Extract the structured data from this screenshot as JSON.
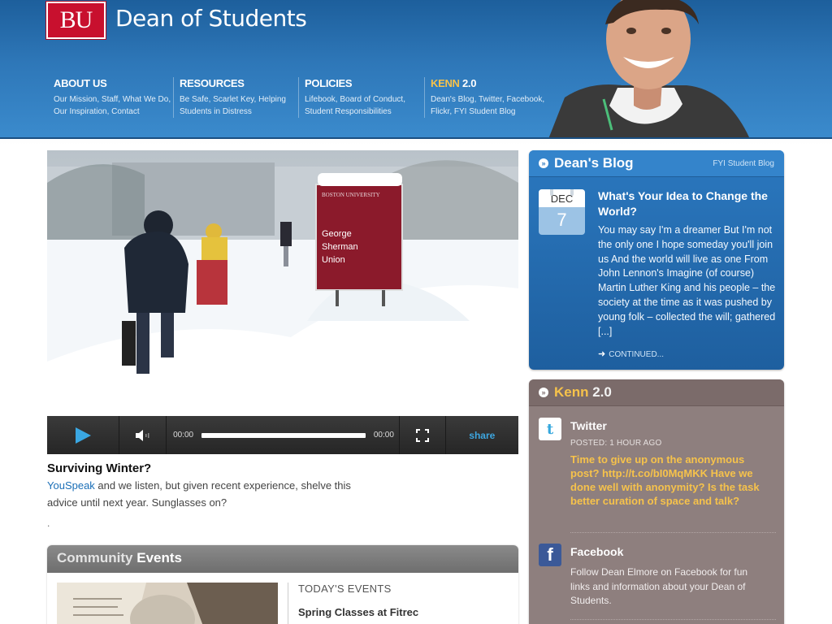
{
  "header": {
    "logo_text": "BU",
    "site_title": "Dean of Students",
    "nav": [
      {
        "title": "ABOUT US",
        "sub": "Our Mission, Staff, What We Do, Our Inspiration, Contact"
      },
      {
        "title": "RESOURCES",
        "sub": "Be Safe, Scarlet Key, Helping Students in Distress"
      },
      {
        "title": "POLICIES",
        "sub": "Lifebook, Board of Conduct, Student Responsibilities"
      },
      {
        "title_hl": "KENN",
        "title_rest": " 2.0",
        "sub": "Dean's Blog, Twitter, Facebook, Flickr, FYI Student Blog"
      }
    ]
  },
  "video": {
    "sign_top": "BOSTON UNIVERSITY",
    "sign_line1": "George",
    "sign_line2": "Sherman",
    "sign_line3": "Union",
    "time_current": "00:00",
    "time_total": "00:00",
    "share_label": "share",
    "caption_title": "Surviving Winter?",
    "caption_link": "YouSpeak",
    "caption_text": " and we listen, but given recent experience, shelve this advice until next year. Sunglasses on?",
    "caption_dot": "."
  },
  "community": {
    "title_light": "Community ",
    "title_bold": "Events",
    "today_label": "TODAY'S EVENTS",
    "event_title": "Spring Classes at Fitrec"
  },
  "blog": {
    "title": "Dean's Blog",
    "link": "FYI Student Blog",
    "cal_month": "DEC",
    "cal_day": "7",
    "post_title": "What's Your Idea to Change the World?",
    "post_body": "You may say I'm a dreamer But I'm not the only one I hope someday you'll join us And the world will live as one From John Lennon's Imagine (of course) Martin Luther King and his people – the society at the time as it was pushed by young folk – collected the will; gathered [...]",
    "continued": "CONTINUED..."
  },
  "kenn": {
    "title_hl": "Kenn",
    "title_rest": " 2.0",
    "twitter_name": "Twitter",
    "twitter_posted": "POSTED: 1 HOUR AGO",
    "tweet": "Time to give up on the anonymous post? http://t.co/bI0MqMKK Have we done well with anonymity? Is the task better curation of space and talk?",
    "facebook_name": "Facebook",
    "facebook_text": "Follow Dean Elmore on Facebook for fun links and information about your Dean of Students."
  },
  "colors": {
    "header_blue": "#2e77b8",
    "bu_red": "#c8102e",
    "accent_gold": "#f6c24b",
    "kenn_panel": "#8e7f7e",
    "link_blue": "#1b6fb7"
  },
  "icons": [
    "play-icon",
    "volume-icon",
    "fullscreen-icon",
    "twitter-icon",
    "facebook-icon",
    "arrow-right-icon",
    "circle-arrow-icon"
  ]
}
